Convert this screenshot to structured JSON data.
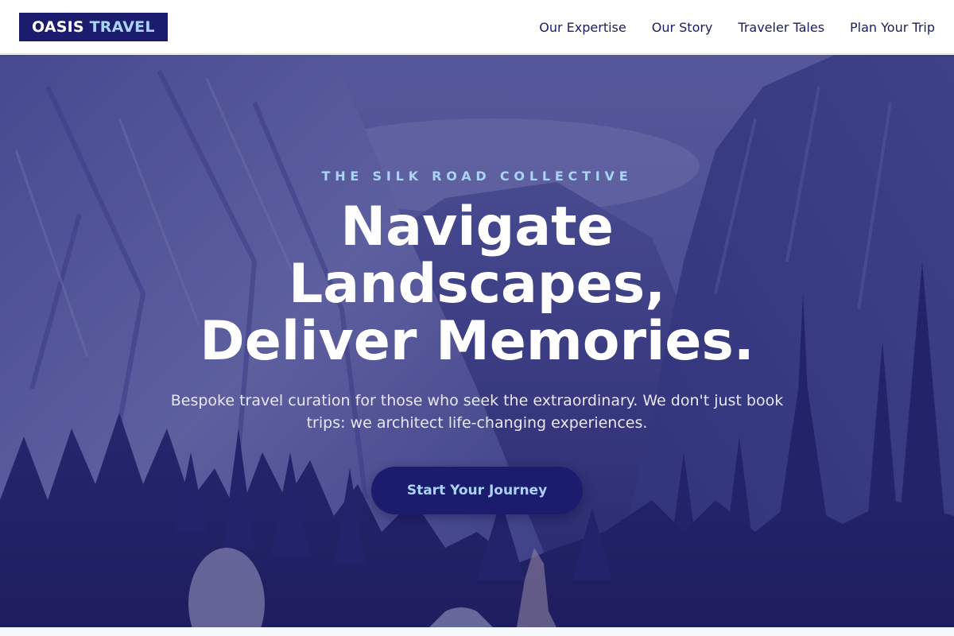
{
  "brand": {
    "name_part1": "OASIS",
    "name_part2": "TRAVEL",
    "colors": {
      "primary_navy": "#1c1c6e",
      "accent_light_blue": "#a9d4f5",
      "nav_text": "#1c1c5e",
      "hero_text": "#ffffff"
    }
  },
  "nav": {
    "items": [
      {
        "label": "Our Expertise"
      },
      {
        "label": "Our Story"
      },
      {
        "label": "Traveler Tales"
      },
      {
        "label": "Plan Your Trip"
      }
    ]
  },
  "hero": {
    "eyebrow": "THE SILK ROAD COLLECTIVE",
    "headline_lines": [
      "Navigate",
      "Landscapes,",
      "Deliver Memories."
    ],
    "subtitle": "Bespoke travel curation for those who seek the extraordinary. We don't just book trips: we architect life-changing experiences.",
    "cta_label": "Start Your Journey"
  }
}
